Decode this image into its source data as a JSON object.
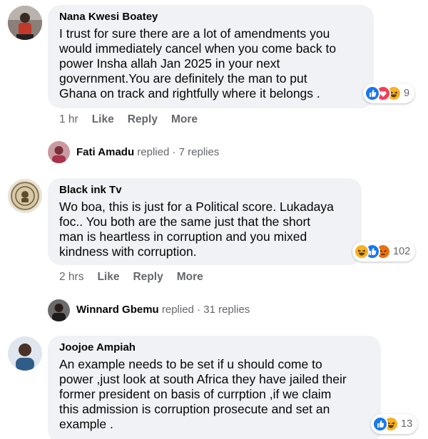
{
  "comments": [
    {
      "author": "Nana Kwesi Boatey",
      "lines": [
        "I trust for sure there are a lot of amendments you",
        "would immediately cancel when you come back to",
        "power Insha allah Jan 2025 in your next",
        "government.You are definitely the man to put",
        "Ghana on track and rightfully where it belongs ."
      ],
      "time": "1 hr",
      "like": "Like",
      "reply": "Reply",
      "more": "More",
      "reaction_count": "9",
      "reactions": [
        "like-icon",
        "love-icon",
        "haha-icon"
      ],
      "replier": "Fati Amadu",
      "replied_text": "replied",
      "replies_text": "· 7 replies"
    },
    {
      "author": "Black ink Tv",
      "lines": [
        "Wo boa, this is just for a Political score. Lukadaya",
        "foc.. You both are the same just that the short",
        "man is heartless in corruption and you mixed",
        "kindness with corruption."
      ],
      "time": "2 hrs",
      "like": "Like",
      "reply": "Reply",
      "more": "More",
      "reaction_count": "102",
      "reactions": [
        "haha-icon",
        "like-icon",
        "angry-icon"
      ],
      "replier": "Winnard Gbemu",
      "replied_text": "replied",
      "replies_text": "· 31 replies"
    },
    {
      "author": "Joojoe Ampiah",
      "lines": [
        "An example needs to be set if u should come to",
        "power ,just look at south Africa they have jailed their",
        "former president on basis of currption ,if we claim",
        "this admission is corruption prosecute and set an",
        "example ."
      ],
      "reaction_count": "13",
      "reactions": [
        "like-icon",
        "haha-icon"
      ]
    }
  ],
  "colors": {
    "bubble": "#f0f2f5",
    "secondary_text": "#65676b",
    "like_blue": "#1877f2",
    "love_red": "#f33e58",
    "haha_yellow": "#f7b125",
    "angry_orange": "#e9710f"
  }
}
